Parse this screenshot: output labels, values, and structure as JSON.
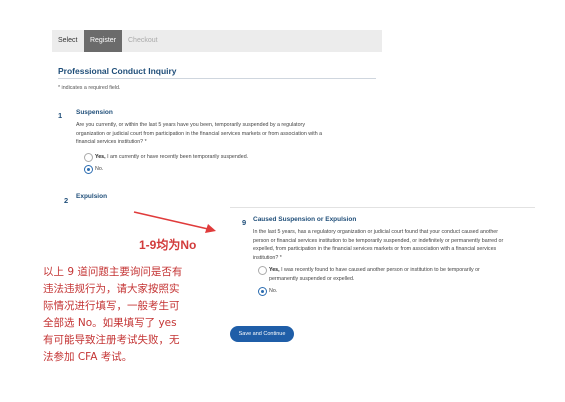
{
  "steps": {
    "select": "Select",
    "register": "Register",
    "checkout": "Checkout"
  },
  "page": {
    "title": "Professional Conduct Inquiry",
    "required_note": "* indicates a required field."
  },
  "q1": {
    "number": "1",
    "title": "Suspension",
    "text_lines": [
      "Are you currently, or within the last 5 years have you been, temporarily suspended by a regulatory",
      "organization or judicial court from participation in the financial services markets or from association with a",
      "financial services institution? *"
    ],
    "opt_yes_bold": "Yes,",
    "opt_yes_rest": " I am currently or have recently been temporarily suspended.",
    "opt_no": "No."
  },
  "q2": {
    "number": "2",
    "title": "Expulsion"
  },
  "q9": {
    "number": "9",
    "title": "Caused Suspension or Expulsion",
    "text_lines": [
      "In the last 5 years, has a regulatory organization or judicial court found that your conduct caused another",
      "person or financial services institution to be temporarily suspended, or indefinitely or permanently barred or",
      "expelled, from participation in the financial services markets or from association with a financial services",
      "institution? *"
    ],
    "opt_yes_bold": "Yes,",
    "opt_yes_rest_lines": [
      " I was recently found to have caused another person or institution to be temporarily or",
      "permanently suspended or expelled."
    ],
    "opt_no": "No."
  },
  "buttons": {
    "continue": "Save and Continue"
  },
  "annotations": {
    "label": "1-9均为No",
    "paragraph_lines": [
      "以上 9 道问题主要询问是否有",
      "违法违规行为，请大家按照实",
      "际情况进行填写，一般考生可",
      "全部选 No。如果填写了 yes",
      "有可能导致注册考试失败，无",
      "法参加 CFA 考试。"
    ]
  },
  "colors": {
    "accent": "#1f4e79",
    "button": "#1f5ea8",
    "annotation": "#d23b3b"
  }
}
